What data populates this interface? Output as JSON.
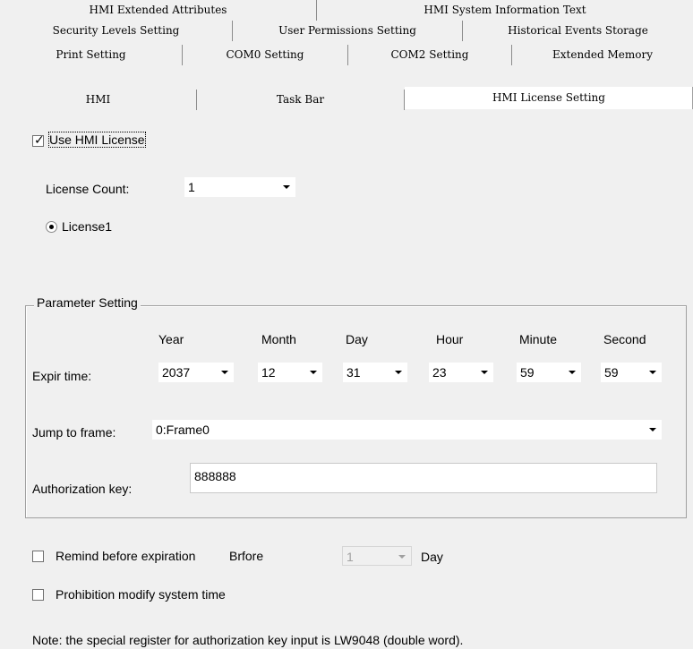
{
  "tabs": {
    "row1": [
      "HMI Extended Attributes",
      "HMI System Information Text"
    ],
    "row2": [
      "Security Levels Setting",
      "User Permissions Setting",
      "Historical Events Storage"
    ],
    "row3": [
      "Print Setting",
      "COM0 Setting",
      "COM2 Setting",
      "Extended Memory"
    ],
    "row4": [
      "HMI",
      "Task Bar",
      "HMI License Setting"
    ]
  },
  "license": {
    "use_label": "Use HMI License",
    "use_checked": true,
    "count_label": "License Count:",
    "count_value": "1",
    "radio_label": "License1"
  },
  "params": {
    "legend": "Parameter Setting",
    "headers": [
      "Year",
      "Month",
      "Day",
      "Hour",
      "Minute",
      "Second"
    ],
    "expire_label": "Expir time:",
    "expire_values": [
      "2037",
      "12",
      "31",
      "23",
      "59",
      "59"
    ],
    "jump_label": "Jump to frame:",
    "jump_value": "0:Frame0",
    "auth_label": "Authorization key:",
    "auth_value": "888888"
  },
  "remind": {
    "label": "Remind before expiration",
    "before_label": "Brfore",
    "before_value": "1",
    "unit": "Day",
    "checked": false
  },
  "prohibit": {
    "label": "Prohibition modify system time",
    "checked": false
  },
  "note": "Note: the special register for authorization key input is LW9048 (double word)."
}
